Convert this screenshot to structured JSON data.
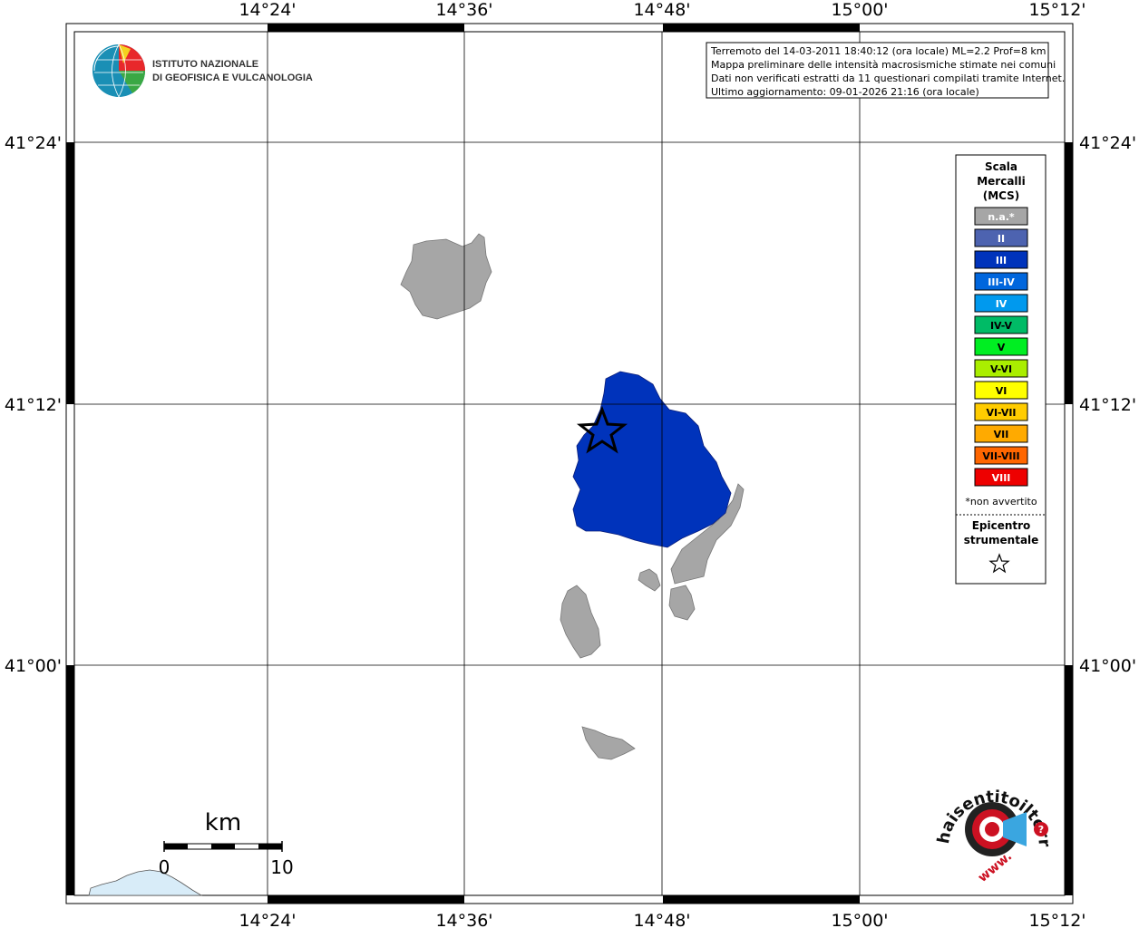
{
  "map": {
    "lon_labels": [
      "14°24'",
      "14°36'",
      "14°48'",
      "15°00'",
      "15°12'"
    ],
    "lat_labels": [
      "41°24'",
      "41°12'",
      "41°00'"
    ]
  },
  "info_box": {
    "lines": [
      "Terremoto del 14-03-2011 18:40:12 (ora locale) ML=2.2 Prof=8 km",
      "Mappa preliminare delle intensità macrosismiche stimate nei comuni",
      "Dati non verificati estratti da 11 questionari compilati tramite Internet.",
      "Ultimo aggiornamento: 09-01-2026 21:16 (ora locale)"
    ]
  },
  "logo": {
    "line1": "ISTITUTO NAZIONALE",
    "line2": "DI GEOFISICA E VULCANOLOGIA"
  },
  "legend": {
    "title": [
      "Scala",
      "Mercalli",
      "(MCS)"
    ],
    "levels": [
      {
        "label": "n.a.*",
        "color": "#a6a6a6",
        "text_color": "#ffffff"
      },
      {
        "label": "II",
        "color": "#4d63b0",
        "text_color": "#ffffff"
      },
      {
        "label": "III",
        "color": "#0033bb",
        "text_color": "#ffffff"
      },
      {
        "label": "III-IV",
        "color": "#0066dd",
        "text_color": "#ffffff"
      },
      {
        "label": "IV",
        "color": "#0099ee",
        "text_color": "#ffffff"
      },
      {
        "label": "IV-V",
        "color": "#00bb66",
        "text_color": "#000000"
      },
      {
        "label": "V",
        "color": "#00ee22",
        "text_color": "#000000"
      },
      {
        "label": "V-VI",
        "color": "#aaee00",
        "text_color": "#000000"
      },
      {
        "label": "VI",
        "color": "#ffff00",
        "text_color": "#000000"
      },
      {
        "label": "VI-VII",
        "color": "#ffcc00",
        "text_color": "#000000"
      },
      {
        "label": "VII",
        "color": "#ffaa00",
        "text_color": "#000000"
      },
      {
        "label": "VII-VIII",
        "color": "#ff6600",
        "text_color": "#000000"
      },
      {
        "label": "VIII",
        "color": "#ee0000",
        "text_color": "#ffffff"
      }
    ],
    "note": "*non avvertito",
    "epicenter_title": [
      "Epicentro",
      "strumentale"
    ],
    "epicenter_symbol": "star-icon"
  },
  "scale_bar": {
    "title": "km",
    "start": "0",
    "end": "10"
  },
  "badge": {
    "text": "haisentitoilterremoto.it",
    "prefix": "www.",
    "accent": "#cc1122"
  },
  "colors": {
    "municipality_intensity": "#0033bb",
    "no_data": "#a6a6a6",
    "sea_coast": "#d8ecf8"
  }
}
